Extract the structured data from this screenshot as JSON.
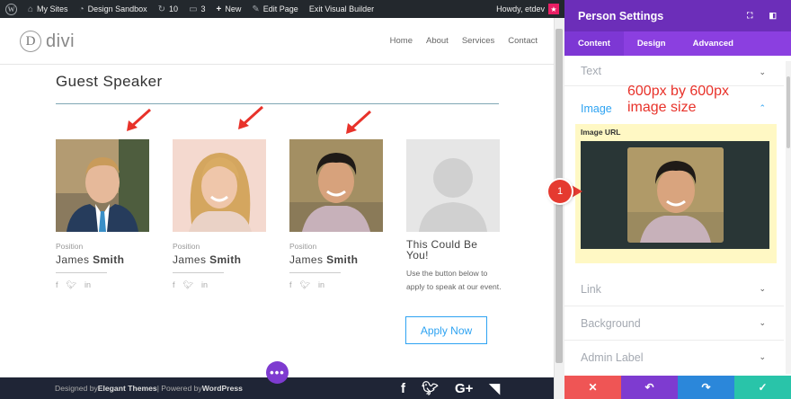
{
  "adminbar": {
    "my_sites": "My Sites",
    "site_name": "Design Sandbox",
    "updates_count": "10",
    "comments_count": "3",
    "new_label": "New",
    "edit_page": "Edit Page",
    "exit_builder": "Exit Visual Builder",
    "howdy": "Howdy, etdev"
  },
  "header": {
    "logo_letter": "D",
    "logo_text": "divi",
    "nav": [
      "Home",
      "About",
      "Services",
      "Contact"
    ]
  },
  "section": {
    "title": "Guest Speaker",
    "people": [
      {
        "position": "Position",
        "first": "James",
        "last": "Smith"
      },
      {
        "position": "Position",
        "first": "James",
        "last": "Smith"
      },
      {
        "position": "Position",
        "first": "James",
        "last": "Smith"
      }
    ],
    "placeholder_card": {
      "title": "This Could Be You!",
      "description": "Use the button below to apply to speak at our event."
    },
    "apply_button": "Apply Now"
  },
  "footer": {
    "designed_by": "Designed by ",
    "elegant": "Elegant Themes",
    "powered": " | Powered by ",
    "wordpress": "WordPress",
    "social_gplus": "G+"
  },
  "panel": {
    "title": "Person Settings",
    "tabs": [
      "Content",
      "Design",
      "Advanced"
    ],
    "sections": {
      "text": "Text",
      "image": "Image",
      "link": "Link",
      "background": "Background",
      "admin_label": "Admin Label"
    },
    "image_url_label": "Image URL",
    "annotation_line1": "600px by 600px",
    "annotation_line2": "image size",
    "marker": "1"
  },
  "colors": {
    "panel_header": "#6c2eb9",
    "tab_bar": "#8b3fe0",
    "accent_blue": "#2ea3f2",
    "annotation_red": "#e8322a",
    "discard": "#ef5555",
    "undo": "#7e3bd0",
    "redo": "#2b87da",
    "save": "#29c4a9"
  }
}
